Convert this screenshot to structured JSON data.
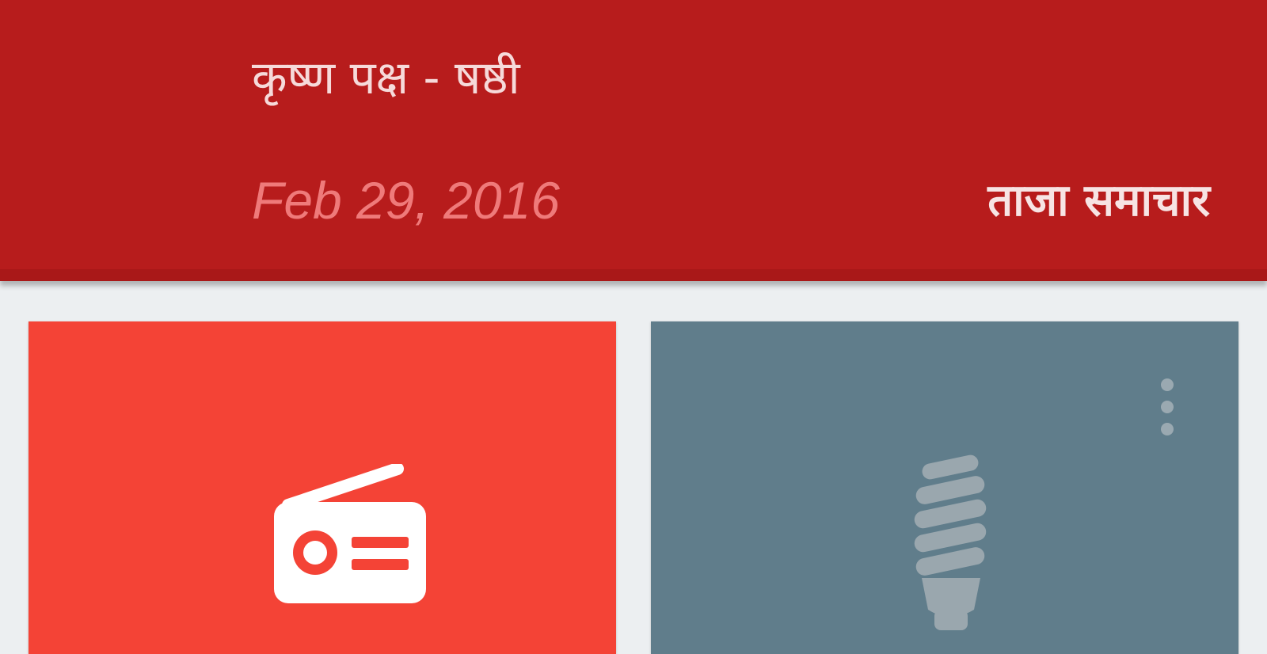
{
  "header": {
    "tithi": "कृष्ण पक्ष - षष्ठी",
    "date": "Feb 29, 2016",
    "news_link": "ताजा समाचार"
  },
  "tiles": [
    {
      "icon": "radio-icon",
      "color": "#f44336"
    },
    {
      "icon": "bulb-icon",
      "color": "#607d8b",
      "menu_icon": "more-vert-icon"
    }
  ],
  "colors": {
    "header_bg": "#b71c1c",
    "page_bg": "#eceff1"
  }
}
